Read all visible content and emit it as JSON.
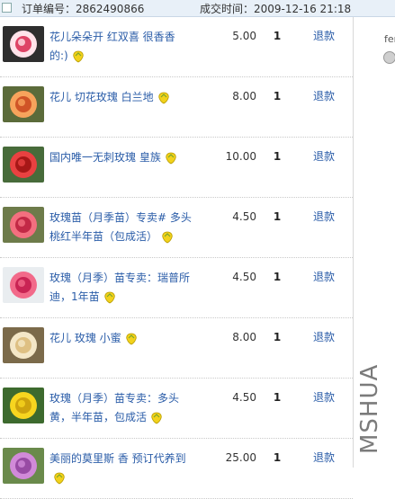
{
  "order": {
    "number_label": "订单编号：2862490866",
    "time_label": "成交时间：2009-12-16 21:18"
  },
  "items": [
    {
      "title": "花儿朵朵开 红双喜 很香香的:)",
      "price": "5.00",
      "qty": "1",
      "refund": "退款",
      "thumb": "rose-bicolor"
    },
    {
      "title": "花儿 切花玫瑰 白兰地",
      "price": "8.00",
      "qty": "1",
      "refund": "退款",
      "thumb": "rose-orange"
    },
    {
      "title": "国内唯一无刺玫瑰 皇族",
      "price": "10.00",
      "qty": "1",
      "refund": "退款",
      "thumb": "rose-red"
    },
    {
      "title": "玫瑰苗（月季苗）专卖# 多头桃红半年苗（包成活）",
      "price": "4.50",
      "qty": "1",
      "refund": "退款",
      "thumb": "rose-pink"
    },
    {
      "title": "玫瑰（月季）苗专卖：瑞普所迪，1年苗",
      "price": "4.50",
      "qty": "1",
      "refund": "退款",
      "thumb": "rose-pink-stem"
    },
    {
      "title": "花儿 玫瑰 小蜜",
      "price": "8.00",
      "qty": "1",
      "refund": "退款",
      "thumb": "rose-cream"
    },
    {
      "title": "玫瑰（月季）苗专卖：多头黄，半年苗，包成活",
      "price": "4.50",
      "qty": "1",
      "refund": "退款",
      "thumb": "rose-yellow"
    },
    {
      "title": "美丽的莫里斯 香 预订代养到",
      "price": "25.00",
      "qty": "1",
      "refund": "退款",
      "thumb": "rose-purple"
    }
  ],
  "side": {
    "user": "fen"
  },
  "watermark": "MSHUA",
  "colors": {
    "link": "#2a5ca8",
    "header_bg": "#e8f0f8"
  }
}
